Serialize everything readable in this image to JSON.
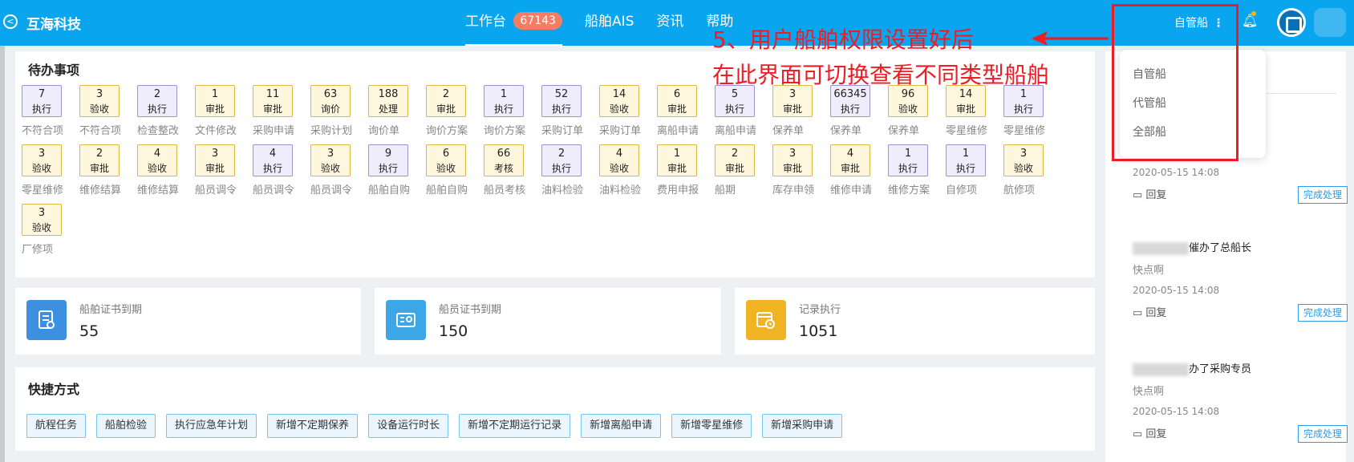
{
  "header": {
    "brand": "互海科技",
    "nav": [
      {
        "label": "工作台",
        "badge": "67143"
      },
      {
        "label": "船舶AIS"
      },
      {
        "label": "资讯"
      },
      {
        "label": "帮助"
      }
    ],
    "ship_type_selected": "自管船"
  },
  "todo": {
    "title": "待办事项",
    "items": [
      {
        "count": "7",
        "action": "执行",
        "label": "不符合项",
        "color": "blue"
      },
      {
        "count": "3",
        "action": "验收",
        "label": "不符合项",
        "color": "yellow"
      },
      {
        "count": "2",
        "action": "执行",
        "label": "检查整改",
        "color": "blue"
      },
      {
        "count": "1",
        "action": "审批",
        "label": "文件修改",
        "color": "yellow"
      },
      {
        "count": "11",
        "action": "审批",
        "label": "采购申请",
        "color": "yellow"
      },
      {
        "count": "63",
        "action": "询价",
        "label": "采购计划",
        "color": "yellow"
      },
      {
        "count": "188",
        "action": "处理",
        "label": "询价单",
        "color": "yellow"
      },
      {
        "count": "2",
        "action": "审批",
        "label": "询价方案",
        "color": "yellow"
      },
      {
        "count": "1",
        "action": "执行",
        "label": "询价方案",
        "color": "blue"
      },
      {
        "count": "52",
        "action": "执行",
        "label": "采购订单",
        "color": "blue"
      },
      {
        "count": "14",
        "action": "验收",
        "label": "采购订单",
        "color": "yellow"
      },
      {
        "count": "6",
        "action": "审批",
        "label": "离船申请",
        "color": "yellow"
      },
      {
        "count": "5",
        "action": "执行",
        "label": "离船申请",
        "color": "blue"
      },
      {
        "count": "3",
        "action": "审批",
        "label": "保养单",
        "color": "yellow"
      },
      {
        "count": "66345",
        "action": "执行",
        "label": "保养单",
        "color": "blue"
      },
      {
        "count": "96",
        "action": "验收",
        "label": "保养单",
        "color": "yellow"
      },
      {
        "count": "14",
        "action": "审批",
        "label": "零星维修",
        "color": "yellow"
      },
      {
        "count": "1",
        "action": "执行",
        "label": "零星维修",
        "color": "blue"
      },
      {
        "count": "3",
        "action": "验收",
        "label": "零星维修",
        "color": "yellow"
      },
      {
        "count": "2",
        "action": "审批",
        "label": "维修结算",
        "color": "yellow"
      },
      {
        "count": "4",
        "action": "验收",
        "label": "维修结算",
        "color": "yellow"
      },
      {
        "count": "3",
        "action": "审批",
        "label": "船员调令",
        "color": "yellow"
      },
      {
        "count": "4",
        "action": "执行",
        "label": "船员调令",
        "color": "blue"
      },
      {
        "count": "3",
        "action": "验收",
        "label": "船员调令",
        "color": "yellow"
      },
      {
        "count": "9",
        "action": "执行",
        "label": "船舶自购",
        "color": "blue"
      },
      {
        "count": "6",
        "action": "验收",
        "label": "船舶自购",
        "color": "yellow"
      },
      {
        "count": "66",
        "action": "考核",
        "label": "船员考核",
        "color": "yellow"
      },
      {
        "count": "2",
        "action": "执行",
        "label": "油料检验",
        "color": "blue"
      },
      {
        "count": "4",
        "action": "验收",
        "label": "油料检验",
        "color": "yellow"
      },
      {
        "count": "1",
        "action": "审批",
        "label": "费用申报",
        "color": "yellow"
      },
      {
        "count": "2",
        "action": "审批",
        "label": "船期",
        "color": "yellow"
      },
      {
        "count": "3",
        "action": "审批",
        "label": "库存申领",
        "color": "yellow"
      },
      {
        "count": "4",
        "action": "审批",
        "label": "维修申请",
        "color": "yellow"
      },
      {
        "count": "1",
        "action": "执行",
        "label": "维修方案",
        "color": "blue"
      },
      {
        "count": "1",
        "action": "执行",
        "label": "自修项",
        "color": "blue"
      },
      {
        "count": "3",
        "action": "验收",
        "label": "航修项",
        "color": "yellow"
      },
      {
        "count": "3",
        "action": "验收",
        "label": "厂修项",
        "color": "yellow"
      }
    ]
  },
  "stats": [
    {
      "label": "船舶证书到期",
      "value": "55",
      "icon": "document-icon",
      "color": "#3d8fe0"
    },
    {
      "label": "船员证书到期",
      "value": "150",
      "icon": "id-card-icon",
      "color": "#3da6e6"
    },
    {
      "label": "记录执行",
      "value": "1051",
      "icon": "calendar-clock-icon",
      "color": "#f0b323"
    }
  ],
  "quick": {
    "title": "快捷方式",
    "buttons": [
      "航程任务",
      "船舶检验",
      "执行应急年计划",
      "新增不定期保养",
      "设备运行时长",
      "新增不定期运行记录",
      "新增离船申请",
      "新增零星维修",
      "新增采购申请"
    ]
  },
  "dropdown": {
    "options": [
      "自管船",
      "代管船",
      "全部船"
    ]
  },
  "messages": [
    {
      "title": "",
      "sub": "",
      "time": "2020-05-15 14:08",
      "reply": "回复",
      "done": "完成处理"
    },
    {
      "title": "催办了总船长",
      "sub": "快点啊",
      "time": "2020-05-15 14:08",
      "reply": "回复",
      "done": "完成处理"
    },
    {
      "title": "办了采购专员",
      "sub": "快点啊",
      "time": "2020-05-15 14:08",
      "reply": "回复",
      "done": "完成处理"
    }
  ],
  "annotation": {
    "line1": "5、用户船舶权限设置好后",
    "line2": "在此界面可切换查看不同类型船舶"
  }
}
